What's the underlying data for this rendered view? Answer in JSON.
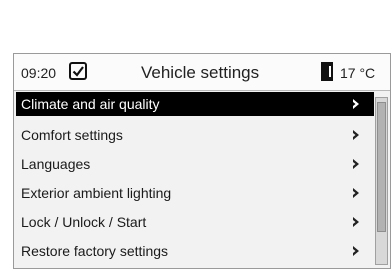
{
  "status": {
    "time": "09:20",
    "title": "Vehicle settings",
    "temperature": "17 °C"
  },
  "menu": {
    "items": [
      {
        "label": "Climate and air quality",
        "selected": true
      },
      {
        "label": "Comfort settings",
        "selected": false
      },
      {
        "label": "Languages",
        "selected": false
      },
      {
        "label": "Exterior ambient lighting",
        "selected": false
      },
      {
        "label": "Lock / Unlock / Start",
        "selected": false
      },
      {
        "label": "Restore factory settings",
        "selected": false
      }
    ]
  },
  "icons": {
    "clock": "clock-check-icon",
    "thermometer": "thermometer-icon",
    "submenu": "chevron-right-icon"
  },
  "colors": {
    "selection_background": "#000000",
    "selection_text": "#ffffff",
    "text": "#1a1a1a"
  }
}
